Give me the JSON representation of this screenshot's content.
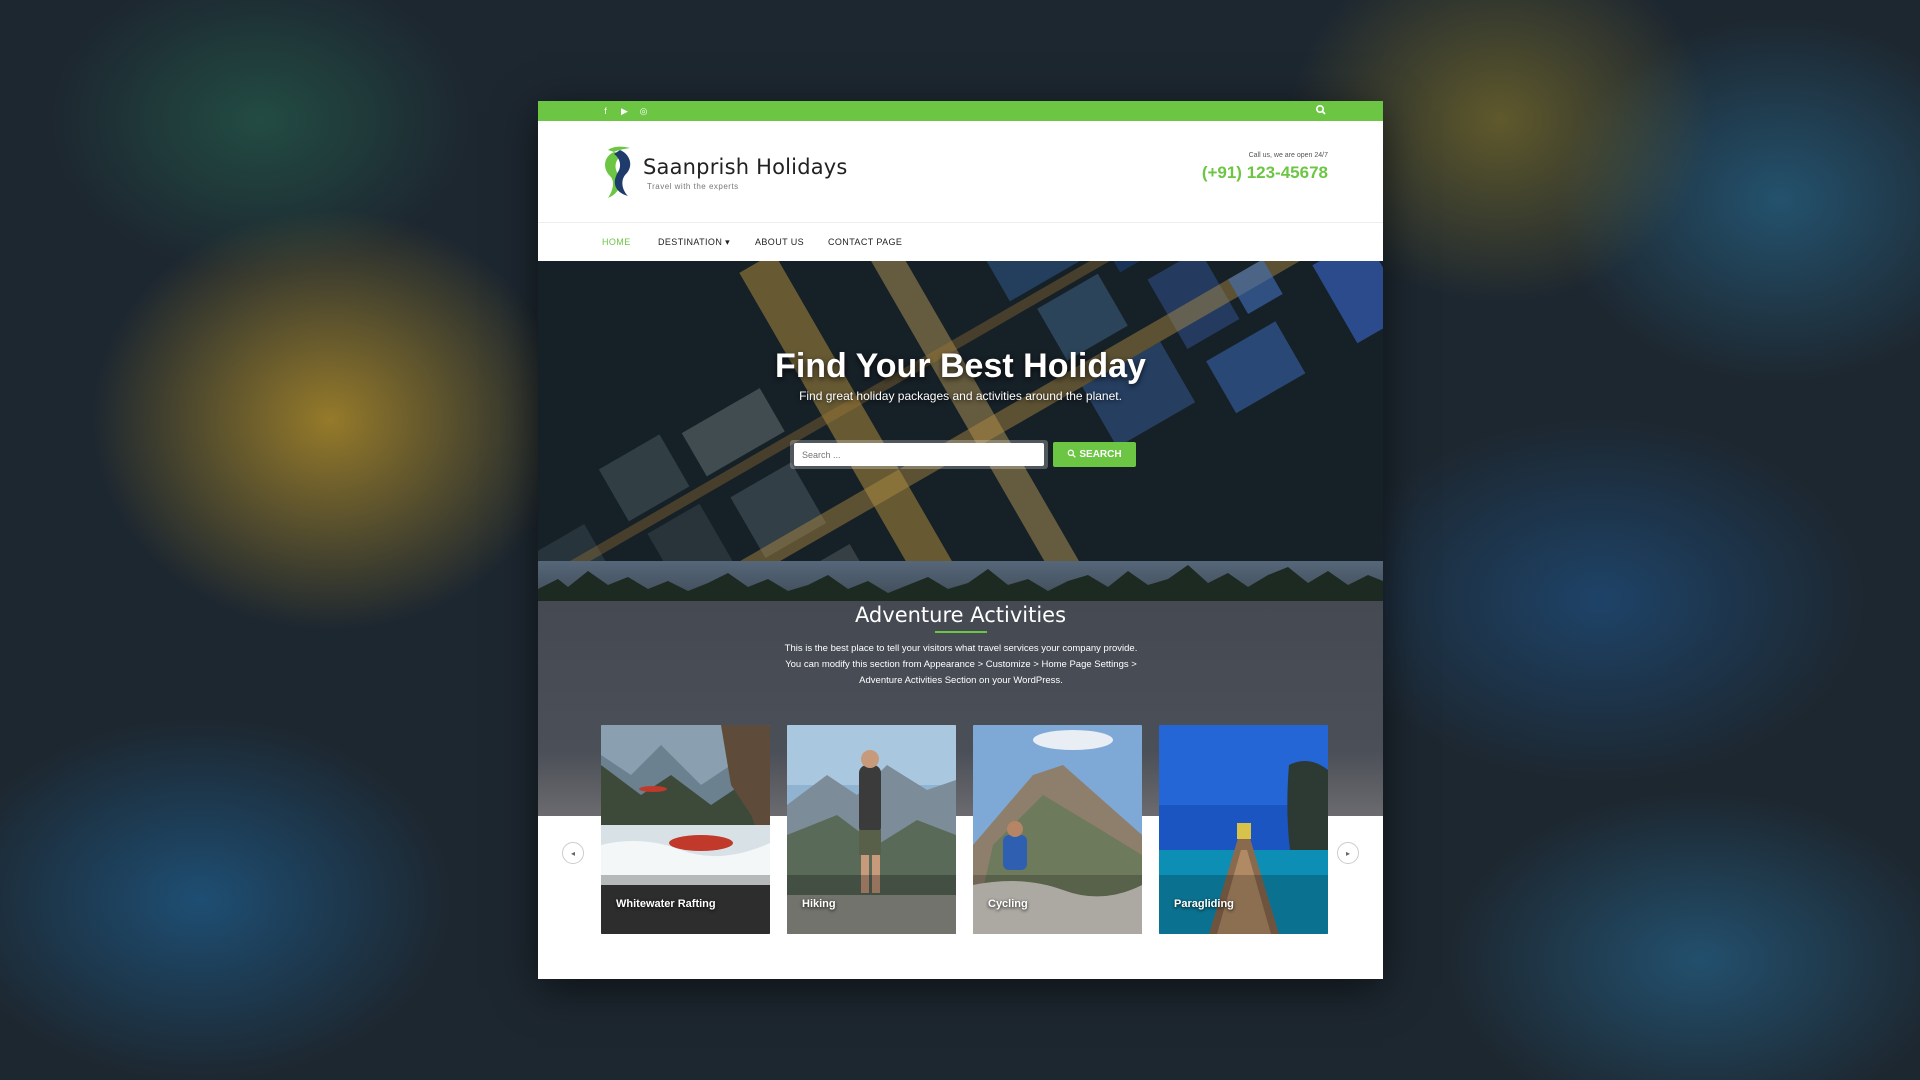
{
  "colors": {
    "accent": "#6cc644",
    "dark_section": "#4a4e56"
  },
  "topbar": {
    "social_icons": [
      "facebook-icon",
      "youtube-icon",
      "instagram-icon"
    ],
    "social_glyphs": [
      "f",
      "▶",
      "◎"
    ]
  },
  "header": {
    "brand": "Saanprish Holidays",
    "tagline": "Travel with the experts",
    "call_note": "Call us, we are open 24/7",
    "phone": "(+91) 123-45678"
  },
  "nav": {
    "items": [
      {
        "label": "HOME"
      },
      {
        "label": "DESTINATION ▾"
      },
      {
        "label": "ABOUT US"
      },
      {
        "label": "CONTACT PAGE"
      }
    ]
  },
  "hero": {
    "title": "Find Your Best Holiday",
    "subtitle": "Find great holiday packages and activities around the planet.",
    "search_placeholder": "Search ...",
    "search_button": "SEARCH"
  },
  "adventure": {
    "title": "Adventure Activities",
    "description": "This is the best place to tell your visitors what travel services your company provide. You can modify this section from Appearance > Customize > Home Page Settings > Adventure Activities Section on your WordPress.",
    "cards": [
      {
        "label": "Whitewater Rafting"
      },
      {
        "label": "Hiking"
      },
      {
        "label": "Cycling"
      },
      {
        "label": "Paragliding"
      }
    ]
  }
}
